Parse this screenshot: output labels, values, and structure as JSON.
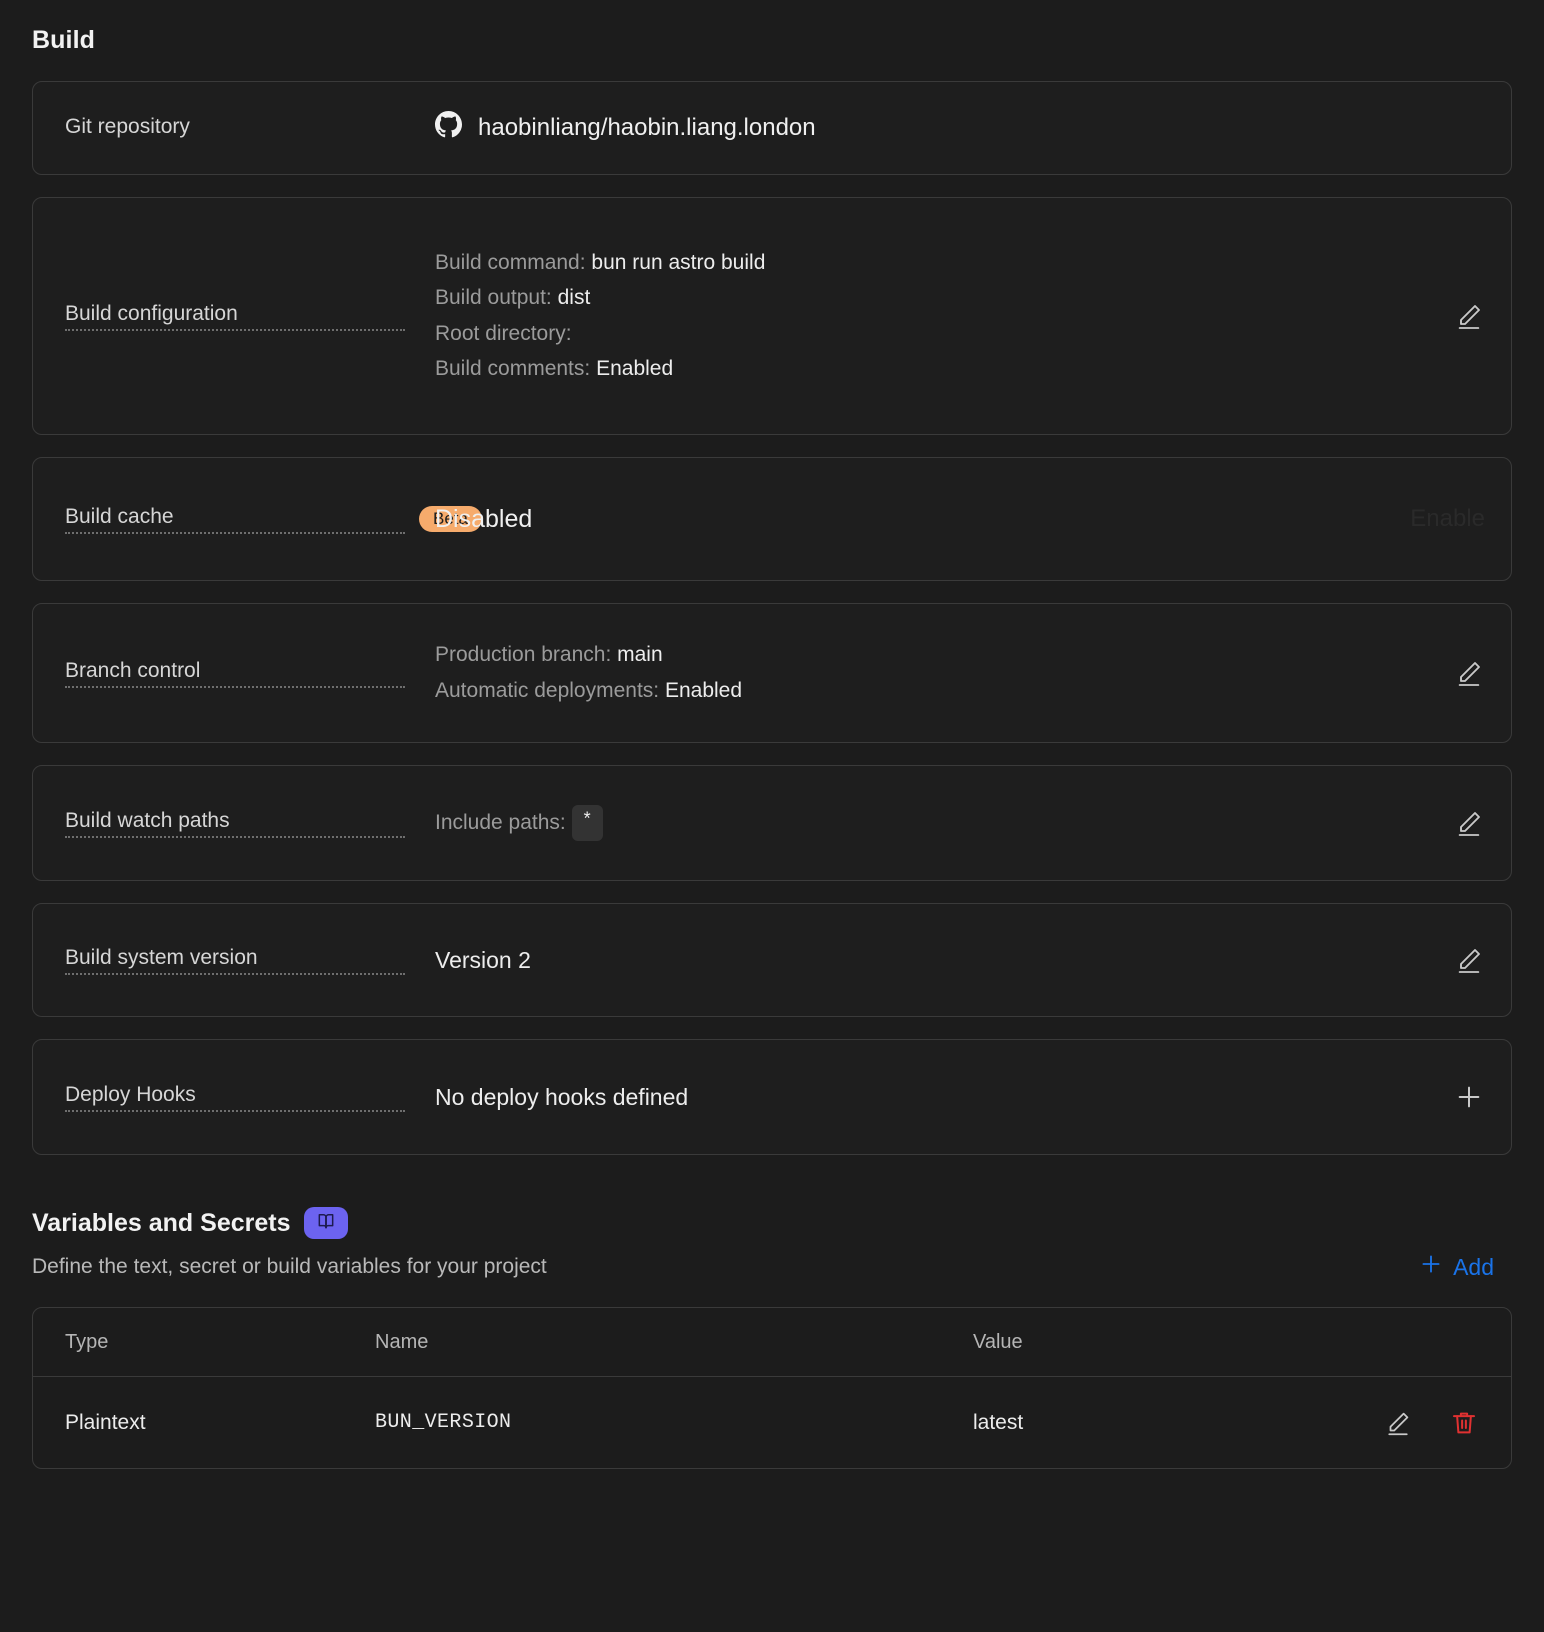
{
  "build": {
    "title": "Build",
    "rows": {
      "git": {
        "label": "Git repository",
        "icon": "github-icon",
        "value": "haobinliang/haobin.liang.london"
      },
      "config": {
        "label": "Build configuration",
        "items": [
          {
            "key": "Build command:",
            "value": "bun run astro build"
          },
          {
            "key": "Build output:",
            "value": "dist"
          },
          {
            "key": "Root directory:",
            "value": ""
          },
          {
            "key": "Build comments:",
            "value": "Enabled"
          }
        ],
        "action": "edit-icon"
      },
      "cache": {
        "label": "Build cache",
        "badge": "Beta",
        "value": "Disabled",
        "action_label": "Enable"
      },
      "branch": {
        "label": "Branch control",
        "items": [
          {
            "key": "Production branch:",
            "value": "main"
          },
          {
            "key": "Automatic deployments:",
            "value": "Enabled"
          }
        ],
        "action": "edit-icon"
      },
      "watch": {
        "label": "Build watch paths",
        "key": "Include paths:",
        "chip": "*",
        "action": "edit-icon"
      },
      "version": {
        "label": "Build system version",
        "value": "Version 2",
        "action": "edit-icon"
      },
      "hooks": {
        "label": "Deploy Hooks",
        "value": "No deploy hooks defined",
        "action": "plus-icon"
      }
    }
  },
  "variables": {
    "title": "Variables and Secrets",
    "docs_badge_icon": "book-icon",
    "subtitle": "Define the text, secret or build variables for your project",
    "add_label": "Add",
    "columns": {
      "type": "Type",
      "name": "Name",
      "value": "Value"
    },
    "rows": [
      {
        "type": "Plaintext",
        "name": "BUN_VERSION",
        "value": "latest"
      }
    ]
  },
  "colors": {
    "background": "#1c1c1c",
    "card_border": "#3a3a3a",
    "beta_badge": "#f6ab6c",
    "docs_badge": "#6c63f0",
    "add_link": "#1a73e8",
    "delete_icon": "#e03131"
  }
}
